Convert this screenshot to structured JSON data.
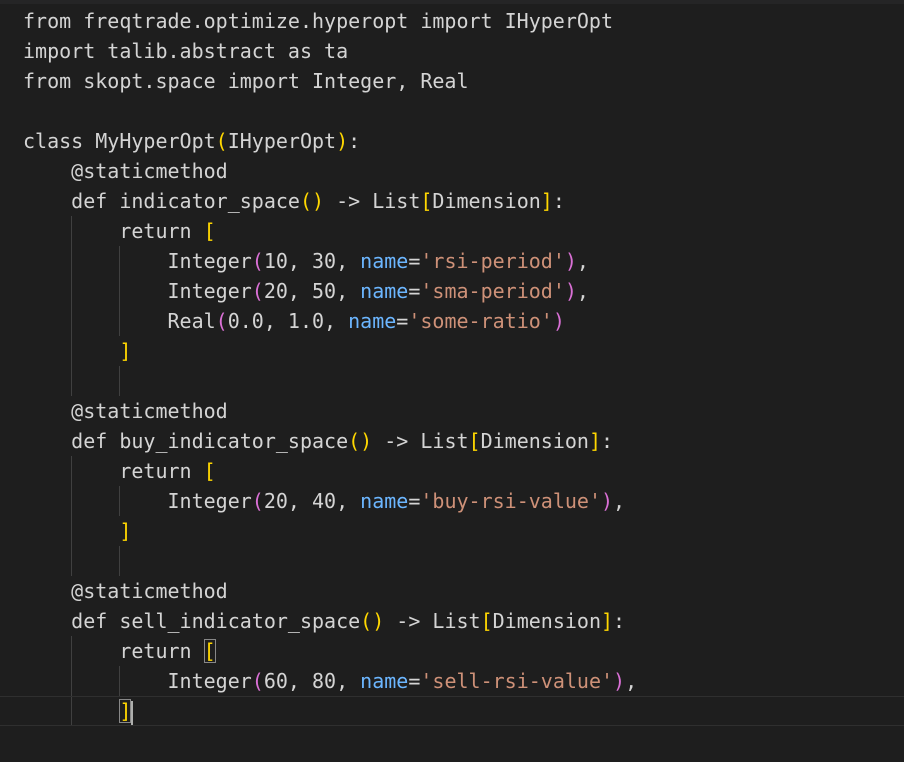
{
  "editor": {
    "lines": [
      [
        {
          "t": "from freqtrade.optimize.hyperopt import IHyperOpt",
          "c": "t-default"
        }
      ],
      [
        {
          "t": "import talib.abstract as ta",
          "c": "t-default"
        }
      ],
      [
        {
          "t": "from skopt.space import Integer, Real",
          "c": "t-default"
        }
      ],
      [],
      [
        {
          "t": "class MyHyperOpt",
          "c": "t-default"
        },
        {
          "t": "(",
          "c": "t-paren-y"
        },
        {
          "t": "IHyperOpt",
          "c": "t-default"
        },
        {
          "t": ")",
          "c": "t-paren-y"
        },
        {
          "t": ":",
          "c": "t-default"
        }
      ],
      [
        {
          "t": "    @staticmethod",
          "c": "t-deco"
        }
      ],
      [
        {
          "t": "    def indicator_space",
          "c": "t-default"
        },
        {
          "t": "()",
          "c": "t-paren-y"
        },
        {
          "t": " -> List",
          "c": "t-default"
        },
        {
          "t": "[",
          "c": "t-paren-y"
        },
        {
          "t": "Dimension",
          "c": "t-default"
        },
        {
          "t": "]",
          "c": "t-paren-y"
        },
        {
          "t": ":",
          "c": "t-default"
        }
      ],
      [
        {
          "t": "        return ",
          "c": "t-default"
        },
        {
          "t": "[",
          "c": "t-paren-y"
        }
      ],
      [
        {
          "t": "            Integer",
          "c": "t-default"
        },
        {
          "t": "(",
          "c": "t-paren-p"
        },
        {
          "t": "10, 30, ",
          "c": "t-default"
        },
        {
          "t": "name",
          "c": "t-param"
        },
        {
          "t": "=",
          "c": "t-default"
        },
        {
          "t": "'rsi-period'",
          "c": "t-string"
        },
        {
          "t": ")",
          "c": "t-paren-p"
        },
        {
          "t": ",",
          "c": "t-default"
        }
      ],
      [
        {
          "t": "            Integer",
          "c": "t-default"
        },
        {
          "t": "(",
          "c": "t-paren-p"
        },
        {
          "t": "20, 50, ",
          "c": "t-default"
        },
        {
          "t": "name",
          "c": "t-param"
        },
        {
          "t": "=",
          "c": "t-default"
        },
        {
          "t": "'sma-period'",
          "c": "t-string"
        },
        {
          "t": ")",
          "c": "t-paren-p"
        },
        {
          "t": ",",
          "c": "t-default"
        }
      ],
      [
        {
          "t": "            Real",
          "c": "t-default"
        },
        {
          "t": "(",
          "c": "t-paren-p"
        },
        {
          "t": "0.0, 1.0, ",
          "c": "t-default"
        },
        {
          "t": "name",
          "c": "t-param"
        },
        {
          "t": "=",
          "c": "t-default"
        },
        {
          "t": "'some-ratio'",
          "c": "t-string"
        },
        {
          "t": ")",
          "c": "t-paren-p"
        }
      ],
      [
        {
          "t": "        ",
          "c": "t-default"
        },
        {
          "t": "]",
          "c": "t-paren-y"
        }
      ],
      [],
      [
        {
          "t": "    @staticmethod",
          "c": "t-deco"
        }
      ],
      [
        {
          "t": "    def buy_indicator_space",
          "c": "t-default"
        },
        {
          "t": "()",
          "c": "t-paren-y"
        },
        {
          "t": " -> List",
          "c": "t-default"
        },
        {
          "t": "[",
          "c": "t-paren-y"
        },
        {
          "t": "Dimension",
          "c": "t-default"
        },
        {
          "t": "]",
          "c": "t-paren-y"
        },
        {
          "t": ":",
          "c": "t-default"
        }
      ],
      [
        {
          "t": "        return ",
          "c": "t-default"
        },
        {
          "t": "[",
          "c": "t-paren-y"
        }
      ],
      [
        {
          "t": "            Integer",
          "c": "t-default"
        },
        {
          "t": "(",
          "c": "t-paren-p"
        },
        {
          "t": "20, 40, ",
          "c": "t-default"
        },
        {
          "t": "name",
          "c": "t-param"
        },
        {
          "t": "=",
          "c": "t-default"
        },
        {
          "t": "'buy-rsi-value'",
          "c": "t-string"
        },
        {
          "t": ")",
          "c": "t-paren-p"
        },
        {
          "t": ",",
          "c": "t-default"
        }
      ],
      [
        {
          "t": "        ",
          "c": "t-default"
        },
        {
          "t": "]",
          "c": "t-paren-y"
        }
      ],
      [],
      [
        {
          "t": "    @staticmethod",
          "c": "t-deco"
        }
      ],
      [
        {
          "t": "    def sell_indicator_space",
          "c": "t-default"
        },
        {
          "t": "()",
          "c": "t-paren-y"
        },
        {
          "t": " -> List",
          "c": "t-default"
        },
        {
          "t": "[",
          "c": "t-paren-y"
        },
        {
          "t": "Dimension",
          "c": "t-default"
        },
        {
          "t": "]",
          "c": "t-paren-y"
        },
        {
          "t": ":",
          "c": "t-default"
        }
      ],
      [
        {
          "t": "        return ",
          "c": "t-default"
        },
        {
          "t": "[",
          "c": "t-paren-y",
          "m": true
        }
      ],
      [
        {
          "t": "            Integer",
          "c": "t-default"
        },
        {
          "t": "(",
          "c": "t-paren-p"
        },
        {
          "t": "60, 80, ",
          "c": "t-default"
        },
        {
          "t": "name",
          "c": "t-param"
        },
        {
          "t": "=",
          "c": "t-default"
        },
        {
          "t": "'sell-rsi-value'",
          "c": "t-string"
        },
        {
          "t": ")",
          "c": "t-paren-p"
        },
        {
          "t": ",",
          "c": "t-default"
        }
      ],
      [
        {
          "t": "        ",
          "c": "t-default"
        },
        {
          "t": "]",
          "c": "t-paren-y",
          "m": true,
          "cursor": true
        }
      ]
    ]
  },
  "colors": {
    "background": "#1e1e1e",
    "text": "#d4d4d4",
    "string": "#ce9178",
    "param": "#6cb6ff",
    "bracket_level1": "#ffd700",
    "bracket_level2": "#da70d6"
  }
}
